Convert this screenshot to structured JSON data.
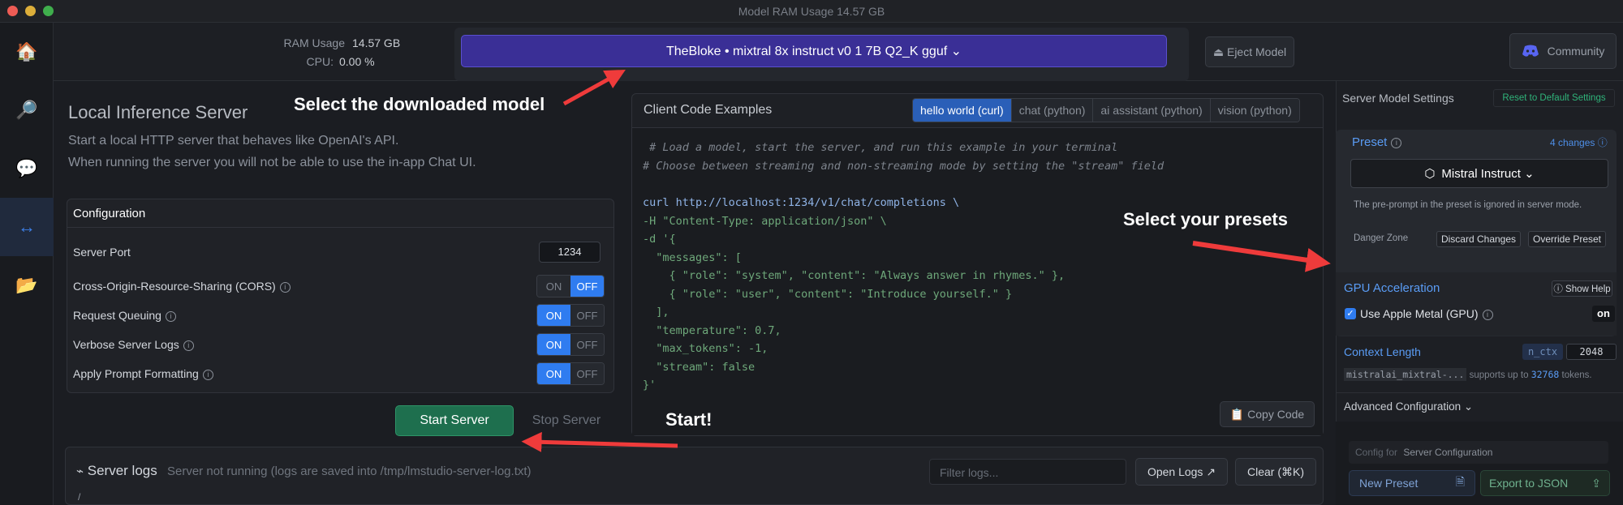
{
  "window": {
    "title": "Model RAM Usage  14.57 GB"
  },
  "rail": {
    "items": [
      {
        "icon": "home-icon",
        "glyph": "🏠"
      },
      {
        "icon": "search-icon",
        "glyph": "🔎"
      },
      {
        "icon": "chat-icon",
        "glyph": "💬"
      },
      {
        "icon": "server-icon",
        "glyph": "↔"
      },
      {
        "icon": "folder-icon",
        "glyph": "📂"
      }
    ]
  },
  "topbar": {
    "ram_label": "RAM Usage",
    "ram_value": "14.57 GB",
    "cpu_label": "CPU:",
    "cpu_value": "0.00 %",
    "model_label": "TheBloke • mixtral 8x instruct v0 1 7B Q2_K gguf ⌄",
    "eject_label": "⏏ Eject Model",
    "community_label": "Community"
  },
  "main": {
    "title": "Local Inference Server",
    "desc1": "Start a local HTTP server that behaves like OpenAI's API.",
    "desc2": "When running the server you will not be able to use the in-app Chat UI.",
    "annotation_model": "Select the downloaded model",
    "annotation_start": "Start!",
    "annotation_presets": "Select your presets"
  },
  "config": {
    "title": "Configuration",
    "port_label": "Server Port",
    "port_value": "1234",
    "rows": [
      {
        "label": "Cross-Origin-Resource-Sharing (CORS)",
        "on": "ON",
        "off": "OFF"
      },
      {
        "label": "Request Queuing",
        "on": "ON",
        "off": "OFF"
      },
      {
        "label": "Verbose Server Logs",
        "on": "ON",
        "off": "OFF"
      },
      {
        "label": "Apply Prompt Formatting",
        "on": "ON",
        "off": "OFF"
      }
    ],
    "info_glyph": "i",
    "start_label": "Start Server",
    "stop_label": "Stop Server"
  },
  "code": {
    "title": "Client Code Examples",
    "tabs": [
      "hello world (curl)",
      "chat (python)",
      "ai assistant (python)",
      "vision (python)"
    ],
    "lines": [
      " # Load a model, start the server, and run this example in your terminal",
      "# Choose between streaming and non-streaming mode by setting the \"stream\" field",
      "",
      "curl http://localhost:1234/v1/chat/completions \\",
      "-H \"Content-Type: application/json\" \\",
      "-d '{",
      "  \"messages\": [",
      "    { \"role\": \"system\", \"content\": \"Always answer in rhymes.\" },",
      "    { \"role\": \"user\", \"content\": \"Introduce yourself.\" }",
      "  ],",
      "  \"temperature\": 0.7,",
      "  \"max_tokens\": -1,",
      "  \"stream\": false",
      "}'"
    ],
    "copy_label": "📋 Copy Code"
  },
  "logs": {
    "title": "Server logs",
    "status": "Server not running (logs are saved into /tmp/lmstudio-server-log.txt)",
    "filter_placeholder": "Filter logs...",
    "open_label": "Open Logs ↗",
    "clear_label": "Clear  (⌘K)",
    "first_char": "/"
  },
  "settings": {
    "title": "Server Model Settings",
    "reset_label": "Reset to Default Settings",
    "preset_label": "Preset",
    "changes_label": "4 changes ⓘ",
    "preset_value": "Mistral Instruct ⌄",
    "preset_note": "The pre-prompt in the preset is ignored in server mode.",
    "danger_label": "Danger Zone",
    "discard_label": "Discard Changes",
    "override_label": "Override Preset",
    "gpu_title": "GPU Acceleration",
    "show_help": "ⓘ Show Help",
    "metal_label": "Use Apple Metal (GPU)",
    "metal_value": "on",
    "context_label": "Context Length",
    "n_ctx": "n_ctx",
    "context_value": "2048",
    "model_short": "mistralai_mixtral-...",
    "supports_text": "supports up to",
    "max_tokens": "32768",
    "tokens_text": "tokens.",
    "advanced_label": "Advanced Configuration ⌄",
    "config_for": "Config for",
    "config_for_value": "Server Configuration",
    "new_preset": "New Preset",
    "export_json": "Export to JSON"
  }
}
